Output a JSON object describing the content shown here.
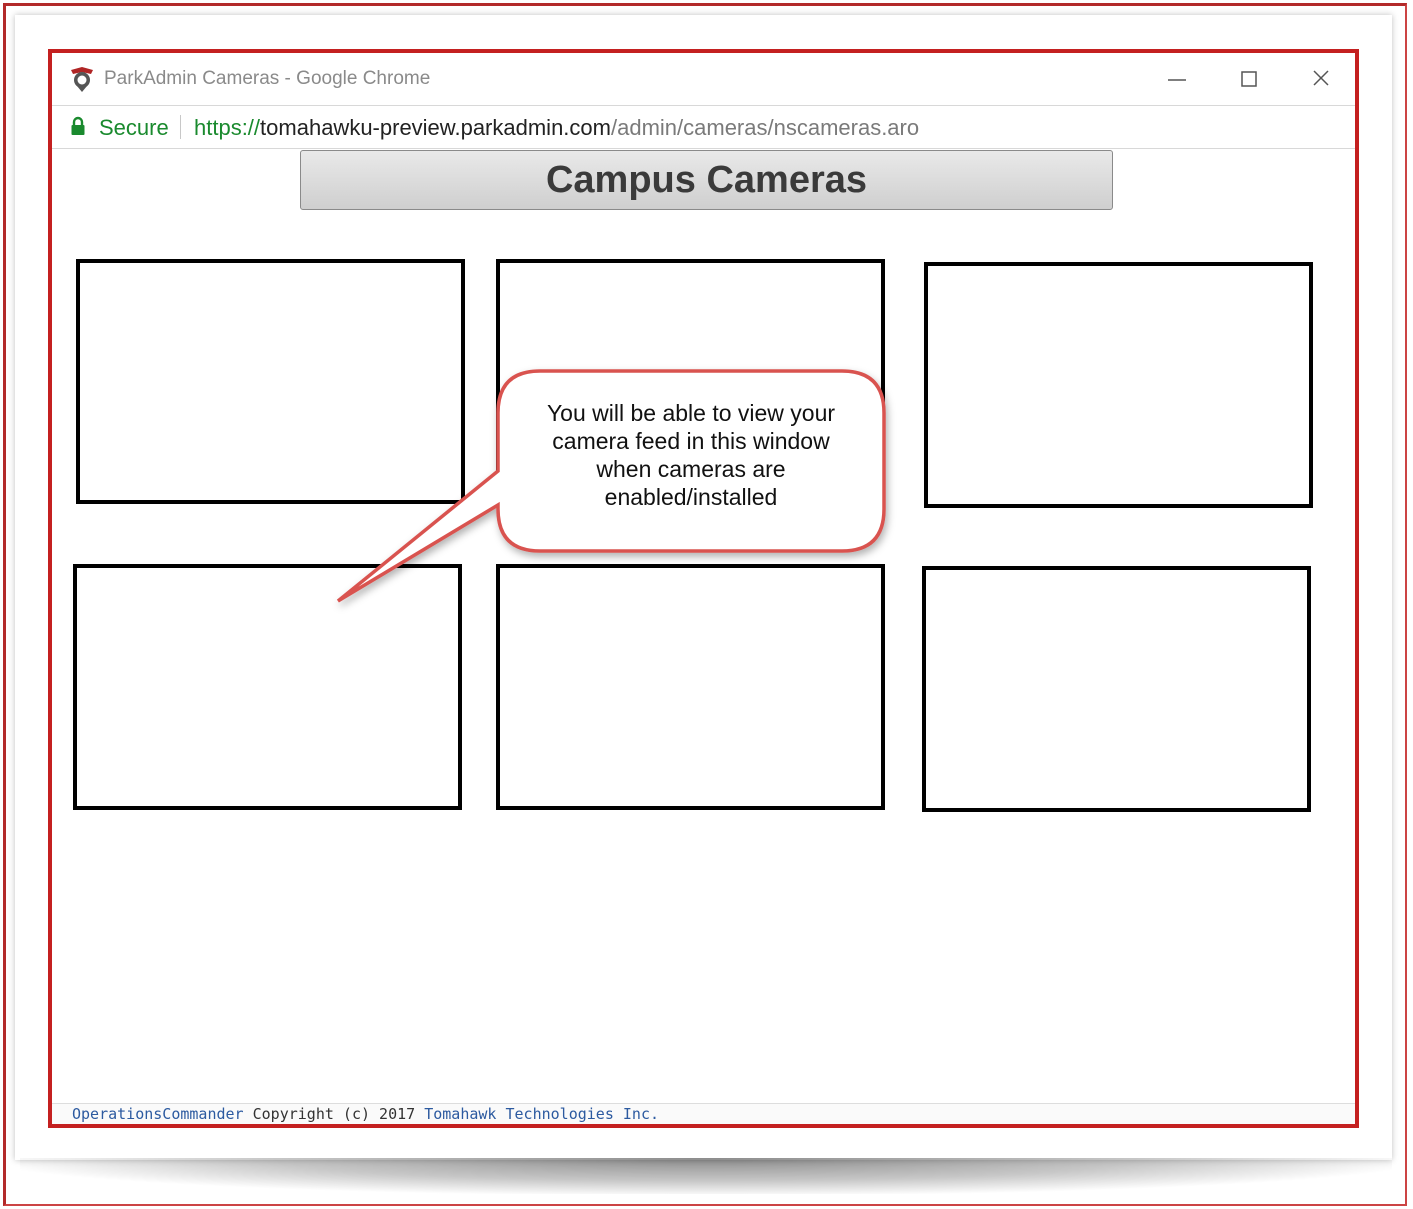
{
  "window": {
    "title": "ParkAdmin Cameras - Google Chrome"
  },
  "addressbar": {
    "secure_label": "Secure",
    "url_scheme": "https://",
    "url_host": "tomahawku-preview.parkadmin.com",
    "url_path": "/admin/cameras/nscameras.aro"
  },
  "page": {
    "title": "Campus Cameras",
    "camera_slots": 6
  },
  "callout": {
    "lines": [
      "You will be able to view your",
      "camera feed in this window",
      "when cameras are",
      "enabled/installed"
    ],
    "color": "#d9534f"
  },
  "footer": {
    "product_link": "OperationsCommander",
    "copyright": " Copyright (c) 2017 ",
    "company_link": "Tomahawk Technologies Inc."
  },
  "colors": {
    "frame_border": "#c42020",
    "secure_green": "#1a8a2e",
    "link_blue": "#2c5aa0"
  }
}
